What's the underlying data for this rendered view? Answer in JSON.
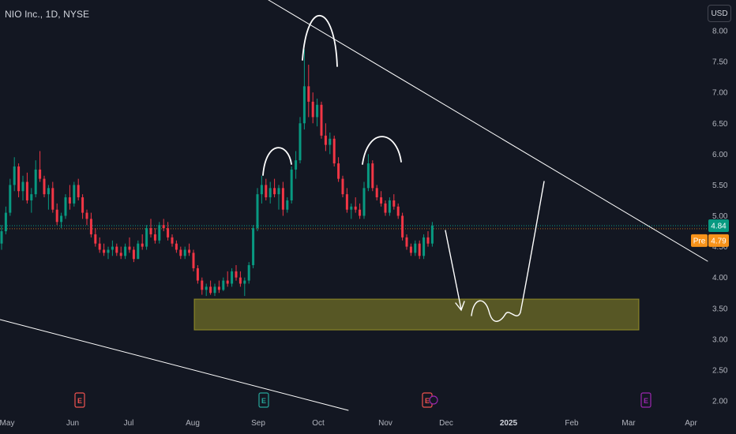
{
  "header": {
    "symbol_title": "NIO Inc., 1D, NYSE"
  },
  "toolbar": {
    "currency_label": "USD"
  },
  "price_badges": {
    "last": {
      "value": "4.84",
      "color": "#089981"
    },
    "pre": {
      "label": "Pre",
      "value": "4.79",
      "color": "#f7931a"
    }
  },
  "chart_data": {
    "type": "candlestick",
    "title": "NIO Inc., 1D, NYSE",
    "currency": "USD",
    "y_ticks": [
      "2.00",
      "2.50",
      "3.00",
      "3.50",
      "4.00",
      "4.50",
      "5.00",
      "5.50",
      "6.00",
      "6.50",
      "7.00",
      "7.50",
      "8.00"
    ],
    "ylim": [
      1.85,
      8.15
    ],
    "x_ticks": [
      "May",
      "Jun",
      "Jul",
      "Aug",
      "Sep",
      "Oct",
      "Nov",
      "Dec",
      "2025",
      "Feb",
      "Mar",
      "Apr"
    ],
    "x_ticks_bold": [
      "2025"
    ],
    "grid": false,
    "series": [
      {
        "values": [
          [
            4.55,
            4.85,
            4.45,
            4.75
          ],
          [
            4.75,
            5.15,
            4.7,
            5.05
          ],
          [
            5.05,
            5.6,
            5.0,
            5.5
          ],
          [
            5.5,
            5.95,
            5.4,
            5.8
          ],
          [
            5.8,
            5.85,
            5.3,
            5.4
          ],
          [
            5.4,
            5.65,
            5.25,
            5.55
          ],
          [
            5.55,
            5.7,
            5.2,
            5.25
          ],
          [
            5.25,
            5.45,
            5.05,
            5.35
          ],
          [
            5.35,
            5.9,
            5.3,
            5.75
          ],
          [
            5.75,
            6.05,
            5.55,
            5.6
          ],
          [
            5.6,
            5.65,
            5.3,
            5.35
          ],
          [
            5.35,
            5.5,
            5.1,
            5.45
          ],
          [
            5.45,
            5.55,
            5.05,
            5.1
          ],
          [
            5.1,
            5.2,
            4.85,
            4.9
          ],
          [
            4.9,
            5.05,
            4.8,
            5.0
          ],
          [
            5.0,
            5.35,
            4.95,
            5.3
          ],
          [
            5.3,
            5.5,
            5.1,
            5.2
          ],
          [
            5.2,
            5.55,
            5.15,
            5.5
          ],
          [
            5.5,
            5.6,
            5.25,
            5.3
          ],
          [
            5.3,
            5.35,
            4.95,
            5.05
          ],
          [
            5.05,
            5.1,
            4.85,
            4.95
          ],
          [
            4.95,
            5.05,
            4.65,
            4.7
          ],
          [
            4.7,
            4.8,
            4.5,
            4.55
          ],
          [
            4.55,
            4.65,
            4.4,
            4.45
          ],
          [
            4.45,
            4.55,
            4.35,
            4.4
          ],
          [
            4.4,
            4.5,
            4.3,
            4.45
          ],
          [
            4.45,
            4.6,
            4.35,
            4.5
          ],
          [
            4.5,
            4.55,
            4.35,
            4.4
          ],
          [
            4.4,
            4.5,
            4.3,
            4.35
          ],
          [
            4.35,
            4.55,
            4.3,
            4.5
          ],
          [
            4.5,
            4.65,
            4.4,
            4.45
          ],
          [
            4.45,
            4.5,
            4.25,
            4.3
          ],
          [
            4.3,
            4.6,
            4.3,
            4.55
          ],
          [
            4.55,
            4.7,
            4.45,
            4.5
          ],
          [
            4.5,
            4.85,
            4.45,
            4.8
          ],
          [
            4.8,
            4.95,
            4.65,
            4.7
          ],
          [
            4.7,
            4.8,
            4.55,
            4.6
          ],
          [
            4.6,
            4.9,
            4.55,
            4.85
          ],
          [
            4.85,
            4.95,
            4.75,
            4.8
          ],
          [
            4.8,
            4.9,
            4.6,
            4.65
          ],
          [
            4.65,
            4.7,
            4.5,
            4.55
          ],
          [
            4.55,
            4.6,
            4.4,
            4.45
          ],
          [
            4.45,
            4.5,
            4.3,
            4.35
          ],
          [
            4.35,
            4.5,
            4.3,
            4.45
          ],
          [
            4.45,
            4.55,
            4.35,
            4.4
          ],
          [
            4.4,
            4.45,
            4.1,
            4.15
          ],
          [
            4.15,
            4.2,
            3.9,
            3.95
          ],
          [
            3.95,
            4.0,
            3.72,
            3.8
          ],
          [
            3.8,
            3.9,
            3.7,
            3.85
          ],
          [
            3.85,
            3.95,
            3.72,
            3.75
          ],
          [
            3.75,
            3.9,
            3.7,
            3.85
          ],
          [
            3.85,
            3.95,
            3.75,
            3.8
          ],
          [
            3.8,
            4.0,
            3.78,
            3.95
          ],
          [
            3.95,
            4.1,
            3.85,
            3.9
          ],
          [
            3.9,
            4.15,
            3.85,
            4.1
          ],
          [
            4.1,
            4.2,
            3.95,
            4.0
          ],
          [
            4.0,
            4.1,
            3.85,
            3.9
          ],
          [
            3.9,
            4.0,
            3.7,
            3.95
          ],
          [
            3.95,
            4.25,
            3.9,
            4.2
          ],
          [
            4.2,
            4.85,
            4.15,
            4.8
          ],
          [
            4.8,
            5.45,
            4.75,
            5.35
          ],
          [
            5.35,
            5.65,
            5.2,
            5.5
          ],
          [
            5.5,
            5.6,
            5.25,
            5.3
          ],
          [
            5.3,
            5.55,
            5.2,
            5.45
          ],
          [
            5.45,
            5.6,
            5.3,
            5.35
          ],
          [
            5.35,
            5.5,
            5.1,
            5.45
          ],
          [
            5.45,
            5.55,
            5.0,
            5.1
          ],
          [
            5.1,
            5.3,
            5.05,
            5.25
          ],
          [
            5.25,
            5.8,
            5.2,
            5.75
          ],
          [
            5.75,
            6.05,
            5.6,
            5.9
          ],
          [
            5.9,
            6.6,
            5.85,
            6.5
          ],
          [
            6.5,
            7.7,
            6.4,
            7.1
          ],
          [
            7.1,
            7.45,
            6.6,
            6.85
          ],
          [
            6.85,
            7.0,
            6.5,
            6.6
          ],
          [
            6.6,
            6.9,
            6.45,
            6.8
          ],
          [
            6.8,
            6.85,
            6.25,
            6.3
          ],
          [
            6.3,
            6.5,
            6.05,
            6.15
          ],
          [
            6.15,
            6.35,
            6.0,
            6.25
          ],
          [
            6.25,
            6.3,
            5.8,
            5.85
          ],
          [
            5.85,
            5.95,
            5.55,
            5.6
          ],
          [
            5.6,
            5.65,
            5.3,
            5.35
          ],
          [
            5.35,
            5.45,
            5.05,
            5.1
          ],
          [
            5.1,
            5.2,
            4.95,
            5.15
          ],
          [
            5.15,
            5.3,
            5.05,
            5.1
          ],
          [
            5.1,
            5.2,
            4.95,
            5.0
          ],
          [
            5.0,
            5.55,
            4.95,
            5.45
          ],
          [
            5.45,
            6.0,
            5.4,
            5.85
          ],
          [
            5.85,
            5.9,
            5.4,
            5.45
          ],
          [
            5.45,
            5.5,
            5.25,
            5.3
          ],
          [
            5.3,
            5.4,
            5.15,
            5.2
          ],
          [
            5.2,
            5.25,
            5.0,
            5.05
          ],
          [
            5.05,
            5.3,
            5.0,
            5.25
          ],
          [
            5.25,
            5.35,
            5.1,
            5.15
          ],
          [
            5.15,
            5.2,
            4.95,
            5.0
          ],
          [
            5.0,
            5.05,
            4.6,
            4.65
          ],
          [
            4.65,
            4.7,
            4.45,
            4.5
          ],
          [
            4.5,
            4.55,
            4.35,
            4.4
          ],
          [
            4.4,
            4.6,
            4.35,
            4.55
          ],
          [
            4.55,
            4.6,
            4.3,
            4.35
          ],
          [
            4.35,
            4.7,
            4.3,
            4.65
          ],
          [
            4.65,
            4.75,
            4.5,
            4.55
          ],
          [
            4.55,
            4.9,
            4.5,
            4.84
          ]
        ]
      }
    ],
    "levels": {
      "last_price": 4.84,
      "pre_market": 4.79
    },
    "annotations": {
      "support_zone": {
        "y_range": [
          3.15,
          3.65
        ],
        "color": "#c9c02a"
      },
      "trendlines": 2,
      "head_and_shoulders_arcs": 3,
      "projection_path": "down to the support zone, double bottom, then breakout up"
    },
    "earnings_markers": [
      {
        "month": "Jun",
        "label": "E",
        "color": "#ef5350"
      },
      {
        "month": "Sep",
        "label": "E",
        "color": "#26a69a"
      },
      {
        "month": "Nov",
        "label": "E",
        "color": "#ef5350"
      },
      {
        "month": "Mar",
        "label": "E",
        "color": "#9c27b0"
      }
    ]
  }
}
